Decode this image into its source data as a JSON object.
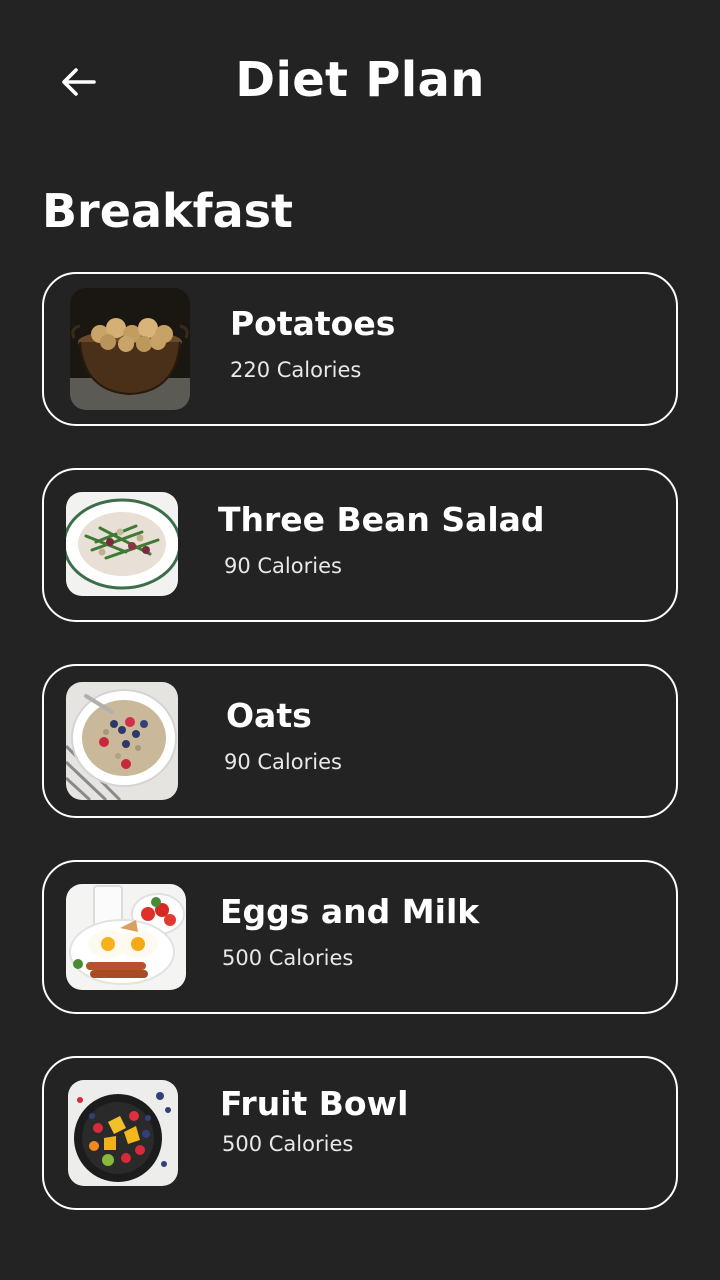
{
  "header": {
    "title": "Diet Plan",
    "back_icon": "arrow-left-icon"
  },
  "section": {
    "title": "Breakfast"
  },
  "meals": [
    {
      "name": "Potatoes",
      "calories": "220 Calories",
      "image": "potatoes-photo"
    },
    {
      "name": "Three Bean Salad",
      "calories": "90 Calories",
      "image": "three-bean-salad-photo"
    },
    {
      "name": "Oats",
      "calories": "90 Calories",
      "image": "oats-photo"
    },
    {
      "name": "Eggs and Milk",
      "calories": "500 Calories",
      "image": "eggs-and-milk-photo"
    },
    {
      "name": "Fruit Bowl",
      "calories": "500 Calories",
      "image": "fruit-bowl-photo"
    }
  ],
  "colors": {
    "background": "#232323",
    "text": "#ffffff",
    "card_border": "#ffffff"
  }
}
